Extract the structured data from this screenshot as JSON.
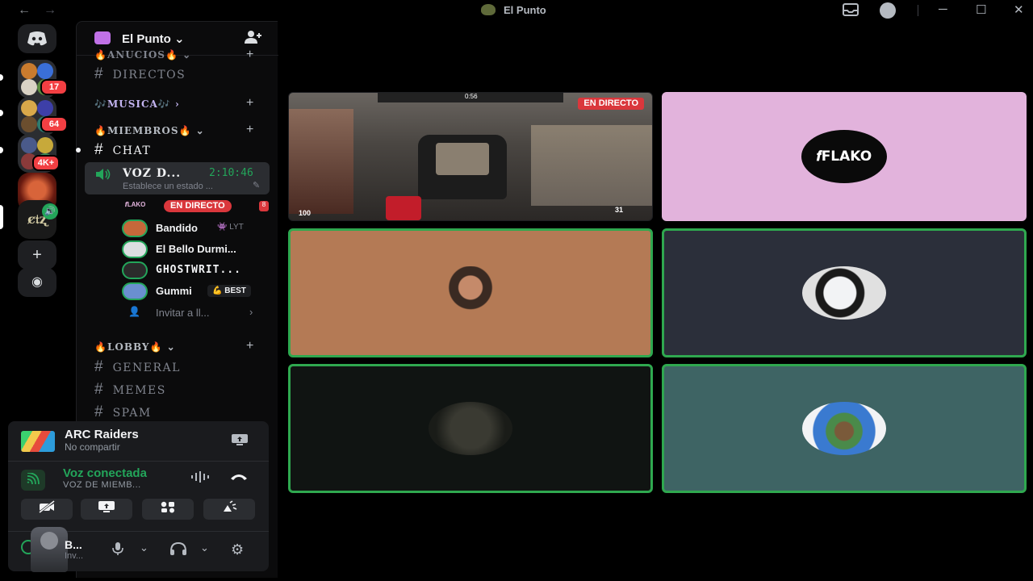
{
  "titlebar": {
    "back": "←",
    "forward": "→",
    "title": "El Punto",
    "inbox_icon": "inbox-icon",
    "help": "?",
    "minimize": "─",
    "maximize": "☐",
    "close": "✕"
  },
  "servers": {
    "items": [
      {
        "badge": "17"
      },
      {
        "badge": "64"
      },
      {
        "badge": "4K+"
      },
      {
        "badge": ""
      },
      {
        "badge": ""
      }
    ],
    "add_label": "+",
    "discover_label": "◉"
  },
  "server_header": {
    "name": "El Punto ⌄"
  },
  "channels": {
    "cat_anuncios": "🔥ANUCIOS🔥 ⌄",
    "directos": "DIRECTOS",
    "cat_musica": "🎶MUSICA🎶 ›",
    "cat_miembros": "🔥MIEMBROS🔥 ⌄",
    "chat": "CHAT",
    "voice": {
      "name": "VOZ D...",
      "time": "2:10:46",
      "status": "Establece un estado ..."
    },
    "members": [
      {
        "name": "",
        "live": "EN DIRECTO"
      },
      {
        "name": "Bandido",
        "activity": "👾 LYT"
      },
      {
        "name": "El Bello Durmi..."
      },
      {
        "name": "GHOSTWRIT..."
      },
      {
        "name": "Gummi",
        "activity": "💪 BEST"
      }
    ],
    "invite": "Invitar a ll...",
    "cat_lobby": "🔥LOBBY🔥 ⌄",
    "general": "GENERAL",
    "memes": "MEMES",
    "spam": "SPAM"
  },
  "activity": {
    "game": "ARC Raiders",
    "share": "No compartir"
  },
  "voice_status": {
    "connected": "Voz conectada",
    "channel": "VOZ DE MIEMB..."
  },
  "user": {
    "name": "B...",
    "status": "Inv..."
  },
  "stage": {
    "live_tag": "EN DIRECTO",
    "hud_ammo": "31",
    "hud_health": "100",
    "hud_timer": "0:56",
    "tiles": [
      {
        "kind": "stream",
        "bg": "#4a4642"
      },
      {
        "kind": "logo",
        "bg": "#e2b3dc",
        "logo_text": "FLAKO"
      },
      {
        "kind": "avatar",
        "bg": "#b47a55",
        "speaking": true
      },
      {
        "kind": "avatar",
        "bg": "#2b2f3a",
        "speaking": true
      },
      {
        "kind": "avatar",
        "bg": "#101412",
        "speaking": true
      },
      {
        "kind": "avatar",
        "bg": "#3e6464",
        "speaking": true
      }
    ]
  },
  "colors": {
    "speaking": "#2fa84f",
    "live": "#da373c",
    "online": "#23a55a",
    "mention": "#f23f43"
  }
}
